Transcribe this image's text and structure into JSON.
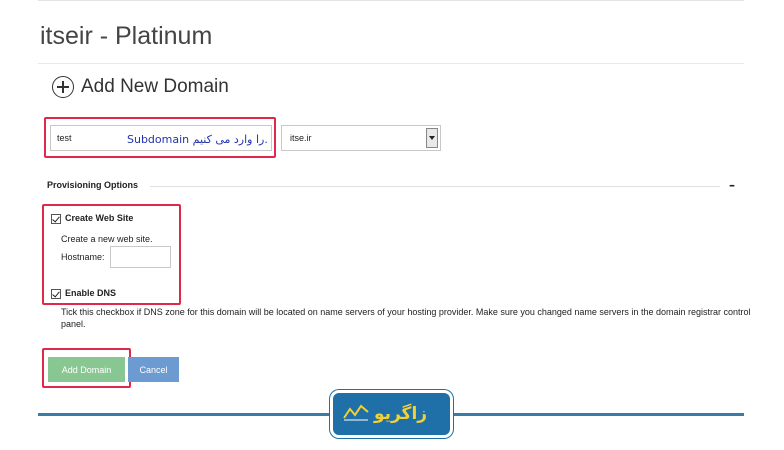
{
  "page": {
    "title": "itseir - Platinum"
  },
  "add_domain": {
    "heading": "Add New Domain",
    "subdomain_value": "test",
    "annotation": "Subdomain  را وارد می کنیم.",
    "domain_select_value": "itse.ir"
  },
  "provisioning": {
    "title": "Provisioning Options",
    "collapse_symbol": "–",
    "create_web_site": {
      "label": "Create Web Site",
      "checked": true,
      "description": "Create a new web site.",
      "hostname_label": "Hostname:",
      "hostname_value": ""
    },
    "enable_dns": {
      "label": "Enable DNS",
      "checked": true,
      "description": "Tick this checkbox if DNS zone for this domain will be located on name servers of your hosting provider. Make sure you changed name servers in the domain registrar control panel."
    }
  },
  "buttons": {
    "add_domain": "Add Domain",
    "cancel": "Cancel"
  },
  "watermark": {
    "text": "زاگریو"
  },
  "colors": {
    "highlight": "#e0284a",
    "add_button": "#89c792",
    "cancel_button": "#6b9bd1",
    "brand": "#1f6fa8",
    "brand_text": "#f5d130"
  }
}
